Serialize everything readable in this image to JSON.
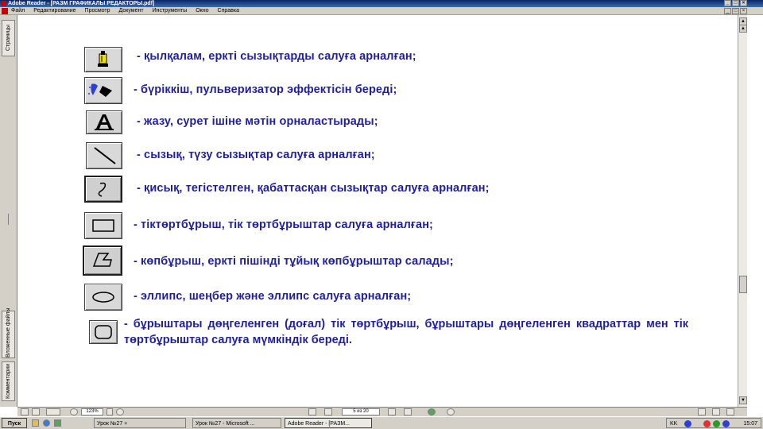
{
  "window": {
    "title": "Adobe Reader - [РАЗМ ГРАФИКАЛЫ РЕДАКТОРЫ.pdf]",
    "min": "_",
    "restore": "□",
    "close": "×"
  },
  "menu": [
    "Файл",
    "Редактирование",
    "Просмотр",
    "Документ",
    "Инструменты",
    "Окно",
    "Справка"
  ],
  "left_tabs": {
    "pages": "Страницы",
    "layers": "Вложенные файлы",
    "comments": "Комментарии"
  },
  "tools": [
    {
      "icon": "pencil-icon",
      "text": "- қылқалам, еркті сызықтарды салуға арналған;"
    },
    {
      "icon": "spray-icon",
      "text": "- бүріккіш, пульверизатор эффектісін береді;"
    },
    {
      "icon": "text-tool-icon",
      "text": "- жазу, сурет ішіне мәтін орналастырады;"
    },
    {
      "icon": "line-icon",
      "text": "- сызық, түзу сызықтар салуға арналған;"
    },
    {
      "icon": "curve-icon",
      "text": "- қисық, тегістелген, қабаттасқан сызықтар салуға арналған;"
    },
    {
      "icon": "rectangle-icon",
      "text": "- тіктөртбұрыш, тік төртбұрыштар салуға арналған;"
    },
    {
      "icon": "polygon-icon",
      "text": "- көпбұрыш, еркті пішінді тұйық көпбұрыштар салады;"
    },
    {
      "icon": "ellipse-icon",
      "text": "- эллипс, шеңбер және эллипс салуға арналған;"
    }
  ],
  "rounded_rect_paragraph": "- бұрыштары дөңгеленген (доғал) тік төртбұрыш, бұрыштары дөңгеленген квадраттар мен тік төртбұрыштар салуға мүмкіндік береді.",
  "statusbar": {
    "zoom": "123%",
    "page": "5 из 20"
  },
  "taskbar": {
    "start": "Пуск",
    "buttons": [
      "Урок №27 +",
      "Урок №27 - Microsoft ...",
      "Adobe Reader - [РАЗМ..."
    ],
    "lang": "KK",
    "clock": "15:07"
  },
  "colors": {
    "text": "#1f1fa0",
    "chrome": "#d4d0c8",
    "titlebar": "#0a246a"
  }
}
